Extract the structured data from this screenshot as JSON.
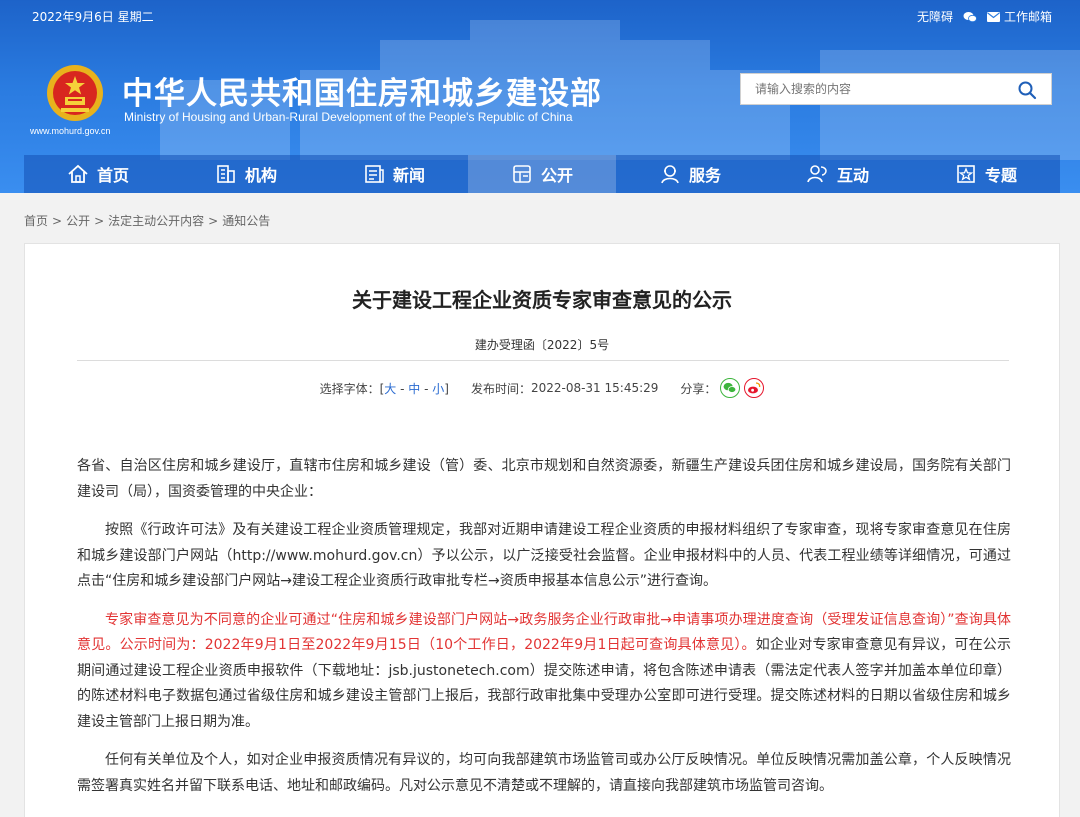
{
  "topbar": {
    "date": "2022年9月6日 星期二",
    "accessibility": "无障碍",
    "wechat_icon": "wechat-icon",
    "mail": "工作邮箱"
  },
  "header": {
    "url": "www.mohurd.gov.cn",
    "title": "中华人民共和国住房和城乡建设部",
    "subtitle": "Ministry of Housing and Urban-Rural Development of the People's Republic of China",
    "search_placeholder": "请输入搜索的内容"
  },
  "nav": {
    "items": [
      {
        "label": "首页",
        "icon": "home-icon"
      },
      {
        "label": "机构",
        "icon": "organization-icon"
      },
      {
        "label": "新闻",
        "icon": "news-icon"
      },
      {
        "label": "公开",
        "icon": "disclosure-icon"
      },
      {
        "label": "服务",
        "icon": "service-icon"
      },
      {
        "label": "互动",
        "icon": "interaction-icon"
      },
      {
        "label": "专题",
        "icon": "topic-icon"
      }
    ],
    "active": "公开"
  },
  "breadcrumb": [
    "首页",
    "公开",
    "法定主动公开内容",
    "通知公告"
  ],
  "article": {
    "title": "关于建设工程企业资质专家审查意见的公示",
    "doc_no": "建办受理函〔2022〕5号",
    "font_size_label": "选择字体：[",
    "font_size_options": [
      "大",
      "中",
      "小"
    ],
    "font_size_close": "]",
    "publish_label": "发布时间：",
    "publish_time": "2022-08-31 15:45:29",
    "share_label": "分享：",
    "paragraphs": {
      "p1": "各省、自治区住房和城乡建设厅，直辖市住房和城乡建设（管）委、北京市规划和自然资源委，新疆生产建设兵团住房和城乡建设局，国务院有关部门建设司（局），国资委管理的中央企业：",
      "p2": "按照《行政许可法》及有关建设工程企业资质管理规定，我部对近期申请建设工程企业资质的申报材料组织了专家审查，现将专家审查意见在住房和城乡建设部门户网站（http://www.mohurd.gov.cn）予以公示，以广泛接受社会监督。企业申报材料中的人员、代表工程业绩等详细情况，可通过点击“住房和城乡建设部门户网站→建设工程企业资质行政审批专栏→资质申报基本信息公示”进行查询。",
      "p3_red": "专家审查意见为不同意的企业可通过“住房和城乡建设部门户网站→政务服务企业行政审批→申请事项办理进度查询（受理发证信息查询）”查询具体意见。公示时间为：2022年9月1日至2022年9月15日（10个工作日，2022年9月1日起可查询具体意见）。",
      "p3_black": "如企业对专家审查意见有异议，可在公示期间通过建设工程企业资质申报软件（下载地址：jsb.justonetech.com）提交陈述申请，将包含陈述申请表（需法定代表人签字并加盖本单位印章）的陈述材料电子数据包通过省级住房和城乡建设主管部门上报后，我部行政审批集中受理办公室即可进行受理。提交陈述材料的日期以省级住房和城乡建设主管部门上报日期为准。",
      "p4": "任何有关单位及个人，如对企业申报资质情况有异议的，均可向我部建筑市场监管司或办公厅反映情况。单位反映情况需加盖公章，个人反映情况需签署真实姓名并留下联系电话、地址和邮政编码。凡对公示意见不清楚或不理解的，请直接向我部建筑市场监管司咨询。"
    }
  },
  "colors": {
    "header_blue": "#2a7be0",
    "red_text": "#e23434",
    "link_blue": "#2a6bd1",
    "wechat_green": "#3db53d",
    "weibo_red": "#e6162d"
  }
}
